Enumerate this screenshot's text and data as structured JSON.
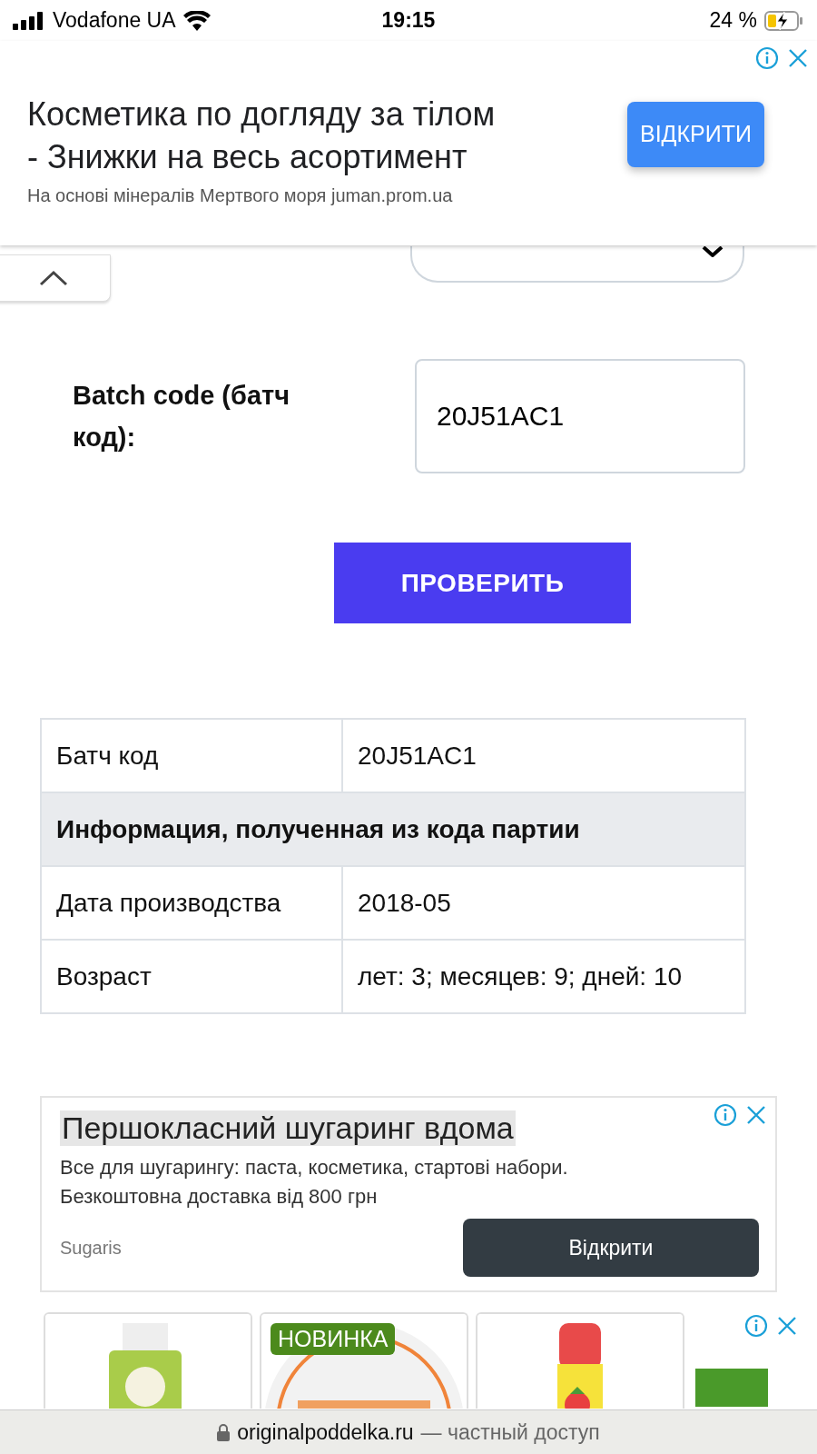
{
  "status_bar": {
    "carrier": "Vodafone UA",
    "time": "19:15",
    "battery": "24 %",
    "charging": true
  },
  "top_ad": {
    "title": "Косметика по догляду за тілом - Знижки на весь асортимент",
    "subtitle": "На основі мінералів Мертвого моря juman.prom.ua",
    "button": "ВІДКРИТИ"
  },
  "form": {
    "batch_label": "Batch code (батч код):",
    "batch_value": "20J51AC1",
    "submit": "ПРОВЕРИТЬ"
  },
  "result_table": {
    "rows": [
      {
        "kind": "pair",
        "label": "Батч код",
        "value": "20J51AC1"
      },
      {
        "kind": "heading",
        "label": "Информация, полученная из кода партии"
      },
      {
        "kind": "pair",
        "label": "Дата производства",
        "value": "2018-05"
      },
      {
        "kind": "pair",
        "label": "Возраст",
        "value": "лет: 3; месяцев: 9; дней: 10"
      }
    ]
  },
  "text_ad": {
    "title": "Першокласний шугаринг вдома",
    "body": "Все для шугарингу: паста, косметика, стартові набори. Безкоштовна доставка від 800 грн",
    "advertiser": "Sugaris",
    "button": "Відкрити"
  },
  "product_ad": {
    "products": [
      {
        "kind": "picture"
      },
      {
        "kind": "picture",
        "badge": "НОВИНКА"
      },
      {
        "kind": "picture"
      }
    ]
  },
  "address_bar": {
    "domain": "originalpoddelka.ru",
    "note": "— частный доступ"
  }
}
